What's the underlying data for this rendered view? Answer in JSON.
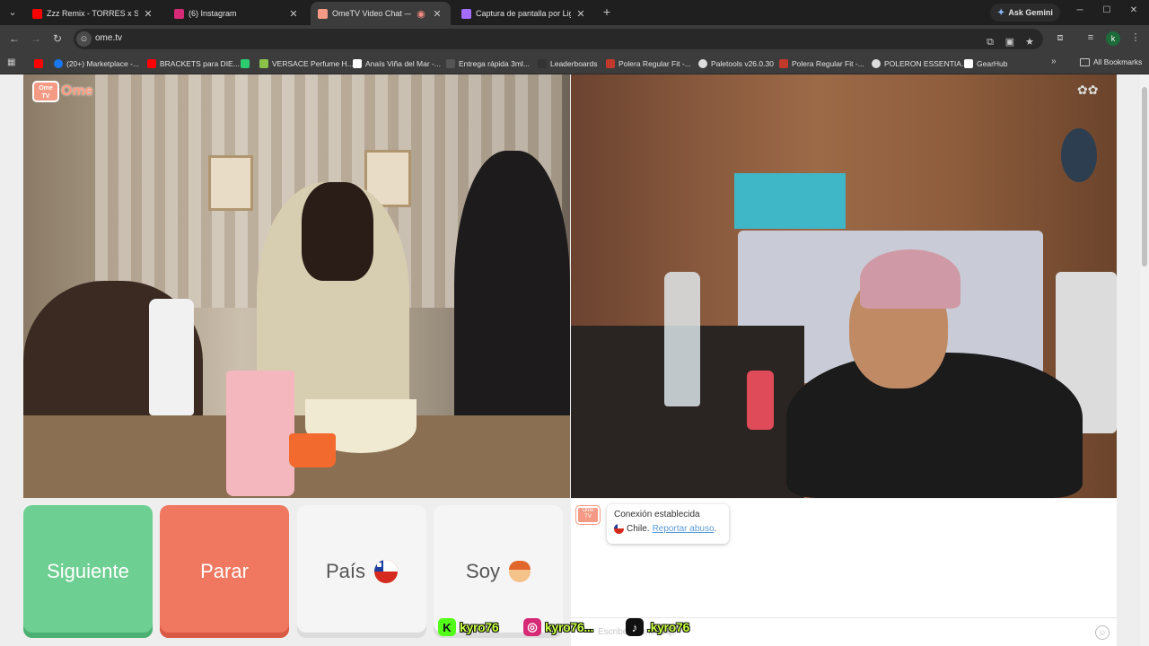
{
  "browser": {
    "tabs": [
      {
        "label": "Zzz Remix - TORRES x Slayter",
        "favicon_color": "#ff0000",
        "active": false
      },
      {
        "label": "(6) Instagram",
        "favicon_color": "#d62976",
        "active": false
      },
      {
        "label": "OmeTV Video Chat — Ome",
        "favicon_color": "#f59a84",
        "active": true
      },
      {
        "label": "Captura de pantalla por Lightshot",
        "favicon_color": "#a66bff",
        "active": false
      }
    ],
    "ask_gemini": "Ask Gemini",
    "url": "ome.tv",
    "profile_initial": "k",
    "bookmarks": [
      {
        "label": "",
        "color": "#ff0000"
      },
      {
        "label": "(20+) Marketplace -...",
        "color": "#1877f2"
      },
      {
        "label": "BRACKETS para DIE...",
        "color": "#ff0000"
      },
      {
        "label": "",
        "color": "#2ecc71"
      },
      {
        "label": "VERSACE Perfume H...",
        "color": "#8bc34a"
      },
      {
        "label": "Anaís Viña del Mar -...",
        "color": "#ffffff"
      },
      {
        "label": "Entrega rápida 3ml...",
        "color": "#555555"
      },
      {
        "label": "Leaderboards",
        "color": "#333333"
      },
      {
        "label": "Polera Regular Fit -...",
        "color": "#c0392b"
      },
      {
        "label": "Paletools v26.0.30",
        "color": "#dddddd"
      },
      {
        "label": "Polera Regular Fit -...",
        "color": "#c0392b"
      },
      {
        "label": "POLERON ESSENTIA...",
        "color": "#dddddd"
      },
      {
        "label": "GearHub",
        "color": "#ffffff"
      }
    ],
    "all_bookmarks": "All Bookmarks"
  },
  "ometv": {
    "logo_text": "Ome",
    "logo_tv": "Ome TV",
    "buttons": {
      "next": "Siguiente",
      "stop": "Parar",
      "country": "País",
      "gender": "Soy"
    },
    "chat": {
      "status": "Conexión establecida",
      "country": "Chile.",
      "report": "Reportar abuso",
      "report_suffix": ".",
      "placeholder": "Escribe un mensaje"
    }
  },
  "overlay": {
    "socials": [
      {
        "platform": "kick",
        "icon": "K",
        "handle": "kyro76",
        "color": "#53fc18"
      },
      {
        "platform": "instagram",
        "icon": "◎",
        "handle": "kyro76...",
        "color": "#d62976"
      },
      {
        "platform": "tiktok",
        "icon": "♪",
        "handle": ".kyro76",
        "color": "#111111"
      }
    ]
  },
  "colors": {
    "next_button": "#6ecf92",
    "stop_button": "#f07760",
    "accent": "#f59a84"
  }
}
